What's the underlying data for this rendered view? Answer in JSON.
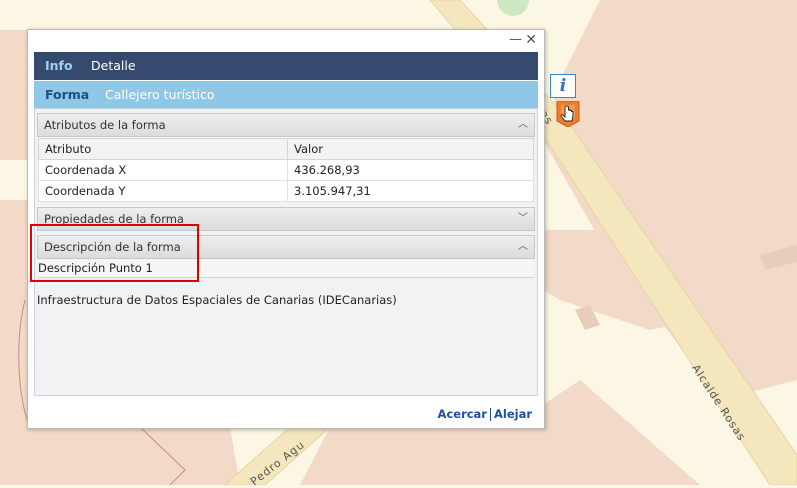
{
  "map": {
    "street_label_1": "Alcalde Rosas",
    "street_label_2": "Pedro Agu",
    "street_fragment": "as"
  },
  "window": {
    "minimize_glyph": "—",
    "close_glyph": "✕"
  },
  "tabs": {
    "level1": [
      {
        "label": "Info"
      },
      {
        "label": "Detalle"
      }
    ],
    "level2": [
      {
        "label": "Forma"
      },
      {
        "label": "Callejero turístico"
      }
    ]
  },
  "sections": {
    "atributos": {
      "title": "Atributos de la forma"
    },
    "propiedades": {
      "title": "Propiedades de la forma"
    },
    "descripcion": {
      "title": "Descripción de la forma",
      "text": "Descripción Punto 1"
    }
  },
  "table": {
    "headers": [
      "Atributo",
      "Valor"
    ],
    "rows": [
      {
        "attr": "Coordenada X",
        "value": "436.268,93"
      },
      {
        "attr": "Coordenada Y",
        "value": "3.105.947,31"
      }
    ]
  },
  "footer": {
    "text": "Infraestructura de Datos Espaciales de Canarias (IDECanarias)"
  },
  "actions": {
    "zoom_in": "Acercar",
    "zoom_out": "Alejar"
  },
  "toolbar": {
    "info_glyph": "i"
  },
  "colors": {
    "map_background": "#fbf7e4",
    "map_parcel": "#f2d9c8",
    "road": "#f4e7bd",
    "tab_bar_dark": "#36496f",
    "tab_bar_light": "#8ec8e6",
    "highlight": "#e00000",
    "marker": "#f07b2c"
  }
}
